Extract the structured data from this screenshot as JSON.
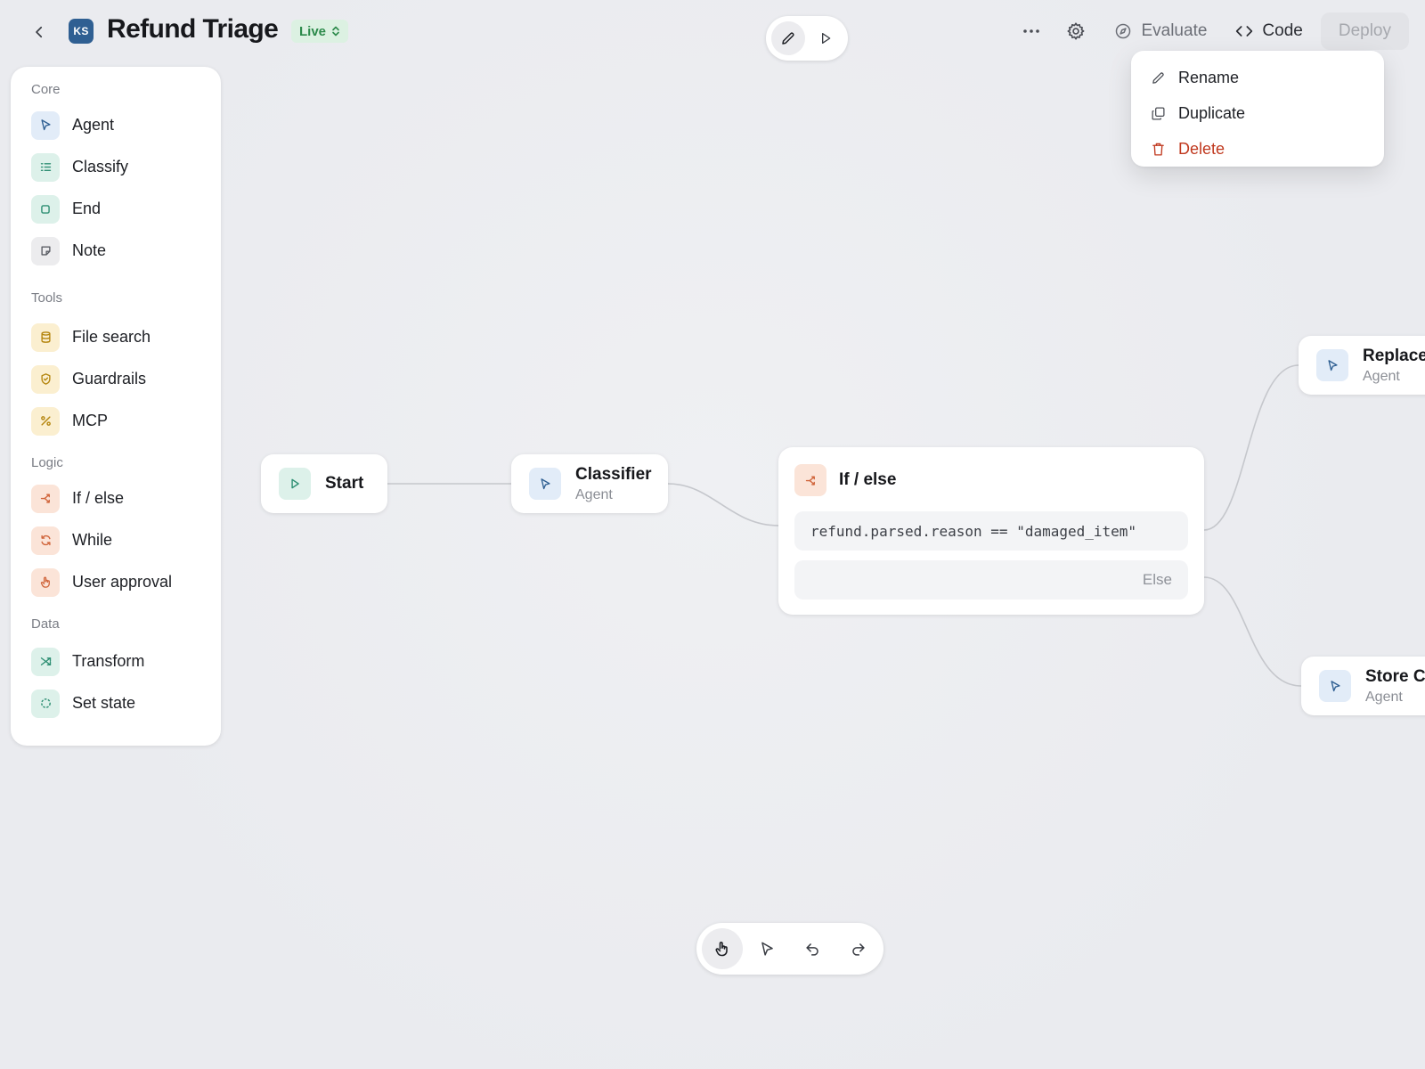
{
  "header": {
    "avatar_initials": "KS",
    "title": "Refund Triage",
    "status_badge": "Live",
    "actions": {
      "evaluate_label": "Evaluate",
      "code_label": "Code",
      "deploy_label": "Deploy"
    }
  },
  "menu": {
    "items": [
      {
        "label": "Rename",
        "icon": "pencil-icon"
      },
      {
        "label": "Duplicate",
        "icon": "copy-icon"
      },
      {
        "label": "Delete",
        "icon": "trash-icon",
        "color": "#c0391f"
      }
    ]
  },
  "sidebar": {
    "groups": [
      {
        "label": "Core",
        "items": [
          {
            "label": "Agent",
            "icon": "agent-icon"
          },
          {
            "label": "Classify",
            "icon": "list-icon"
          },
          {
            "label": "End",
            "icon": "stop-icon"
          },
          {
            "label": "Note",
            "icon": "note-icon"
          }
        ]
      },
      {
        "label": "Tools",
        "items": [
          {
            "label": "File search",
            "icon": "database-icon"
          },
          {
            "label": "Guardrails",
            "icon": "shield-icon"
          },
          {
            "label": "MCP",
            "icon": "mcp-icon"
          }
        ]
      },
      {
        "label": "Logic",
        "items": [
          {
            "label": "If / else",
            "icon": "branch-icon"
          },
          {
            "label": "While",
            "icon": "loop-icon"
          },
          {
            "label": "User approval",
            "icon": "hand-icon"
          }
        ]
      },
      {
        "label": "Data",
        "items": [
          {
            "label": "Transform",
            "icon": "shuffle-icon"
          },
          {
            "label": "Set state",
            "icon": "circle-dashed-icon"
          }
        ]
      }
    ]
  },
  "nodes": {
    "start": {
      "title": "Start"
    },
    "classifier": {
      "title": "Classifier",
      "subtitle": "Agent"
    },
    "ifelse": {
      "title": "If / else",
      "condition": "refund.parsed.reason == \"damaged_item\"",
      "else_label": "Else"
    },
    "replace": {
      "title": "Replace",
      "subtitle": "Agent"
    },
    "store": {
      "title": "Store Cr",
      "subtitle": "Agent"
    }
  },
  "colors": {
    "canvas": "#ecedf0",
    "live_badge_bg": "#dcf1e2",
    "live_badge_text": "#2c8a4b",
    "agent_blue": "#2f5f92",
    "danger": "#c0391f",
    "logic_orange": "#d0643a",
    "data_teal": "#2e8f73",
    "tools_yellow": "#b5860f"
  }
}
